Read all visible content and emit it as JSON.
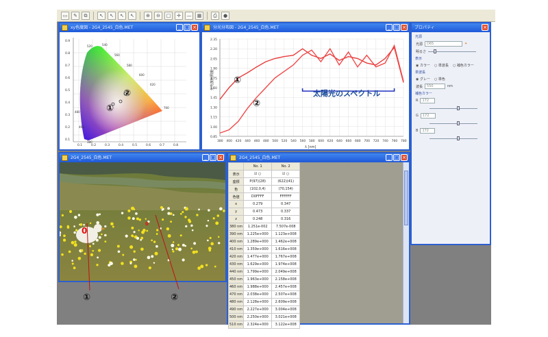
{
  "toolbar": {
    "icons": [
      "folder-icon",
      "wrench-icon",
      "copy-icon",
      "cursor-icon",
      "cursor-plus-icon",
      "cursor-minus-icon",
      "cursor-x-icon",
      "zoom-in-icon",
      "zoom-out-icon",
      "rect-icon",
      "crosshair-icon",
      "line-icon",
      "grid-icon",
      "print-icon",
      "help-icon"
    ]
  },
  "chromaticity": {
    "title": "xy色度図 - 2G4_2545_白色.MET",
    "annotations": [
      "①",
      "②"
    ],
    "x_ticks": [
      "0.1",
      "0.2",
      "0.3",
      "0.4",
      "0.5",
      "0.6",
      "0.7",
      "0.8"
    ],
    "y_ticks": [
      "0.9",
      "0.8",
      "0.7",
      "0.6",
      "0.5",
      "0.4",
      "0.3",
      "0.2",
      "0.1"
    ],
    "wavelength_labels": [
      "520",
      "540",
      "560",
      "580",
      "600",
      "620",
      "700",
      "480",
      "460",
      "380"
    ]
  },
  "spectral": {
    "title": "分光分布図 - 2G4_2545_白色.MET",
    "annotation_text": "太陽光のスペクトル",
    "annotations": [
      "①",
      "②"
    ],
    "xlabel": "λ [nm]",
    "ylabel": "分光放射照度",
    "chart_data": {
      "type": "line",
      "x": [
        380,
        400,
        420,
        440,
        460,
        480,
        500,
        520,
        540,
        560,
        580,
        600,
        620,
        640,
        660,
        680,
        700,
        720,
        740,
        760,
        780
      ],
      "xlim": [
        380,
        780
      ],
      "ylim": [
        0.85,
        2.35
      ],
      "y_ticks": [
        "2.35",
        "2.20",
        "2.05",
        "1.90",
        "1.75",
        "1.60",
        "1.45",
        "1.30",
        "1.15",
        "1.00",
        "0.85"
      ],
      "series": [
        {
          "name": "①",
          "values": [
            1.42,
            1.6,
            1.75,
            1.83,
            1.92,
            2.0,
            2.05,
            2.08,
            2.1,
            2.2,
            2.1,
            2.05,
            2.12,
            2.02,
            2.08,
            2.05,
            1.98,
            1.95,
            2.05,
            2.22,
            1.68
          ]
        },
        {
          "name": "②",
          "values": [
            0.9,
            0.95,
            1.08,
            1.28,
            1.45,
            1.6,
            1.75,
            1.85,
            1.95,
            2.1,
            2.18,
            2.0,
            2.2,
            1.95,
            2.15,
            1.92,
            2.1,
            1.92,
            1.98,
            2.25,
            1.7
          ]
        }
      ],
      "bracket": [
        560,
        760
      ],
      "grid": true
    }
  },
  "photo": {
    "title": "2G4_2545_白色.MET",
    "annotations": [
      "①",
      "②"
    ],
    "markers": [
      "0",
      "0"
    ]
  },
  "table": {
    "title": "2G4_2545_白色.MET",
    "headers": [
      "",
      "No. 1",
      "No. 2"
    ],
    "rows": [
      [
        "表示",
        "☑ ○",
        "☑ ○"
      ],
      [
        "座標",
        "P(97)(28)",
        "(622)(41)"
      ],
      [
        "色",
        "(102,0,4)",
        "(70,154)"
      ],
      [
        "色値",
        "D0FFFF",
        "FFFFFF"
      ],
      [
        "x",
        "0.279",
        "0.347"
      ],
      [
        "y",
        "0.473",
        "0.337"
      ],
      [
        "z",
        "0.248",
        "0.316"
      ],
      [
        "380 nm",
        "1.251e-002",
        "7.507e-008"
      ],
      [
        "390 nm",
        "1.225e+000",
        "1.123e+008"
      ],
      [
        "400 nm",
        "1.289e+000",
        "1.462e+008"
      ],
      [
        "410 nm",
        "1.359e+000",
        "1.616e+008"
      ],
      [
        "420 nm",
        "1.477e+000",
        "1.767e+008"
      ],
      [
        "430 nm",
        "1.629e+000",
        "1.974e+008"
      ],
      [
        "440 nm",
        "1.799e+000",
        "2.049e+008"
      ],
      [
        "450 nm",
        "1.963e+000",
        "2.158e+008"
      ],
      [
        "460 nm",
        "1.988e+000",
        "2.457e+008"
      ],
      [
        "470 nm",
        "2.038e+000",
        "2.507e+008"
      ],
      [
        "480 nm",
        "2.128e+000",
        "2.609e+008"
      ],
      [
        "490 nm",
        "2.227e+000",
        "3.004e+008"
      ],
      [
        "500 nm",
        "2.250e+000",
        "3.021e+008"
      ],
      [
        "510 nm",
        "2.324e+000",
        "3.122e+008"
      ]
    ]
  },
  "props": {
    "title": "プロパティ",
    "group_light": "光源",
    "light_label": "光源",
    "light_value": "D65",
    "brightness_label": "明るさ",
    "group_display": "表示",
    "display_options": [
      "カラー",
      "単波長",
      "補色カラー"
    ],
    "group_single": "単波長",
    "single_options": [
      "グレー",
      "単色"
    ],
    "wavelength_label": "波長",
    "wavelength_value": "550",
    "wavelength_unit": "nm",
    "group_comp": "補色カラー",
    "r_label": "R",
    "g_label": "G",
    "b_label": "B",
    "r_value": "172",
    "g_value": "172",
    "b_value": "172"
  }
}
